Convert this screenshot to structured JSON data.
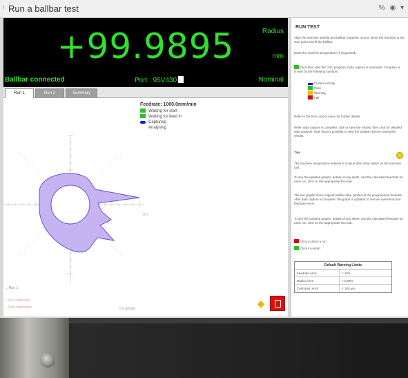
{
  "window": {
    "title": "Run a ballbar test",
    "controls": [
      "%",
      "◉",
      "▾"
    ]
  },
  "display": {
    "value": "+99.9895",
    "mode": "Radius",
    "unit": "mm",
    "connection": "Ballbar connected",
    "port": "Port : 95V430",
    "reference": "Nominal"
  },
  "tabs": [
    {
      "label": "Run 1",
      "active": true
    },
    {
      "label": "Run 2",
      "active": false
    },
    {
      "label": "Summary",
      "active": false
    }
  ],
  "legend": {
    "title": "Feedrate:  1000.0mm/min",
    "items": [
      {
        "label": "Waiting for start",
        "marker": "green"
      },
      {
        "label": "Waiting for feed in",
        "marker": "green"
      },
      {
        "label": "Capturing",
        "marker": "blue"
      },
      {
        "label": "Analysing",
        "marker": "none"
      }
    ]
  },
  "plot_legend": {
    "run": "Run 1",
    "lines": [
      "Pre-calibration",
      "Post-calibration"
    ]
  },
  "scale_label": "5.0 µm/div",
  "colors": {
    "display_bg": "#000000",
    "display_text": "#31e02c",
    "trace_fill": "#c6b4f2",
    "trace_line": "#6a4cd8",
    "stop_button": "#e01010",
    "play_button": "#f2b400"
  },
  "panel": {
    "title": "RUN TEST",
    "p1": "Align the machine spindle and ballbar magnetic mount. Move the machine to the start point and fit the ballbar.",
    "p2": "Enter the machine temperature (if requested).",
    "p3": "Click Run start the CNC program. Data capture is automatic. Progress is shown by the following symbols:",
    "symbols": [
      "Current Activity",
      "Pass",
      "Warning",
      "Fail"
    ],
    "p4": "Refer to the Run control menu for further details.",
    "p5": "When data capture is complete, click to save the results, then click for detailed data analysis. Note that it's possible to view the analysis before saving the results.",
    "tips_title": "Tips",
    "tip1": "The machine temperature entered is a value that of the tables on the machine tool.",
    "tip2": "To see the updated graphs, details of any alerts, and the calculated feedrate for each run, click on the appropriate Run tab.",
    "tip3": "The live graphs show original ballbar data, plotted at the programmed feedrate. After data capture is complete, the graph is updated to remove overshoot and feedrate errors.",
    "tip4": "To see the updated graphs, details of any alerts, and the calculated feedrate for each run, click on the appropriate Run tab.",
    "abort": "Click to abort a run",
    "restart": "Click to restart",
    "limits": {
      "title": "Default Warning Limits",
      "rows": [
        {
          "name": "Feedrate error",
          "value": "< 10%"
        },
        {
          "name": "Radius error",
          "value": "< 0.05%"
        },
        {
          "name": "Centration error",
          "value": "< 100 µm"
        }
      ]
    }
  }
}
